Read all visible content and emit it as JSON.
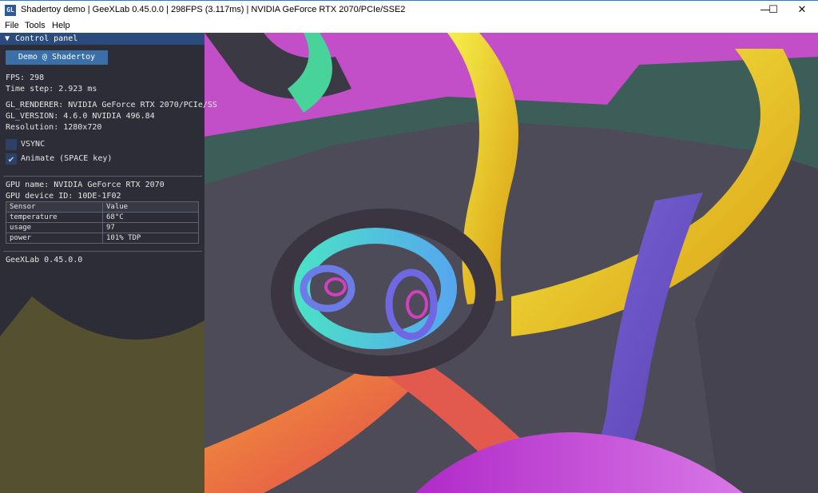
{
  "window": {
    "title": "Shadertoy demo | GeeXLab 0.45.0.0 | 298FPS (3.117ms) | NVIDIA GeForce RTX 2070/PCIe/SSE2",
    "icon_text": "GL",
    "minimize_glyph": "—",
    "maximize_glyph": "☐",
    "close_glyph": "✕"
  },
  "menu": {
    "items": [
      "File",
      "Tools",
      "Help"
    ]
  },
  "panel": {
    "header_arrow": "▼",
    "header": "Control panel",
    "demo_button": "Demo @ Shadertoy",
    "fps": "FPS: 298",
    "time_step": "Time step: 2.923 ms",
    "gl_renderer": "GL_RENDERER: NVIDIA GeForce RTX 2070/PCIe/SS",
    "gl_version": "GL_VERSION: 4.6.0 NVIDIA 496.84",
    "resolution": "Resolution: 1280x720",
    "vsync": {
      "label": "VSYNC",
      "checked": false
    },
    "animate": {
      "label": "Animate (SPACE key)",
      "checked": true,
      "mark": "✔"
    },
    "gpu_name": "GPU name: NVIDIA GeForce RTX 2070",
    "gpu_device_id": "GPU device ID: 10DE-1F02",
    "sensor_table": {
      "headers": [
        "Sensor",
        "Value"
      ],
      "rows": [
        [
          "temperature",
          "68°C"
        ],
        [
          "usage",
          "97"
        ],
        [
          "power",
          "101% TDP"
        ]
      ]
    },
    "footer": "GeeXLab 0.45.0.0"
  },
  "colors": {
    "panel_header": "#2b4b7c",
    "button": "#3a6fa8",
    "checkbox": "#2e4066"
  }
}
